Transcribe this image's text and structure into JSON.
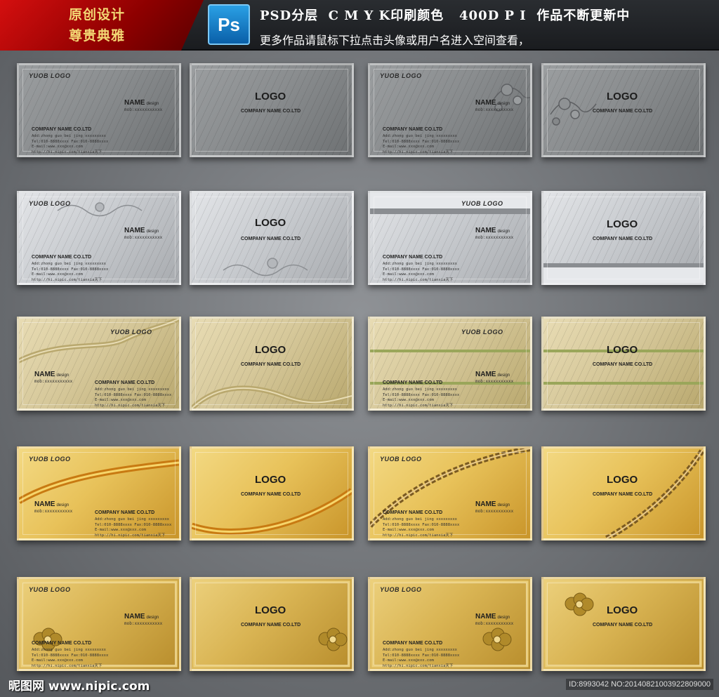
{
  "header": {
    "badge_line1": "原创设计",
    "badge_line2": "尊贵典雅",
    "app_icon": "Ps",
    "line1": "PSD分层  C M Y K印刷颜色   400D P I  作品不断更新中",
    "line2": "更多作品请鼠标下拉点击头像或用户名进入空间查看，"
  },
  "card_text": {
    "corner_logo": "YUOB LOGO",
    "name": "NAME",
    "name_suffix": "design",
    "mob": "mob:xxxxxxxxxxx",
    "company": "COMPANY NAME CO.LTD",
    "info": "Add:zhong guo bei jing xxxxxxxxx\nTel:010-8888xxxx Fax:010-8888xxxx\nE-mail:www.xxx@xxx.com\nhttp://hi.nipic.com/tianxia天下",
    "logo": "LOGO",
    "company_center": "COMPANY NAME CO.LTD"
  },
  "rows": [
    {
      "theme": "dark-silver-pattern",
      "colors": [
        "#8a8d8f",
        "#6e7173",
        "#9b9ea0"
      ]
    },
    {
      "theme": "brushed-silver",
      "colors": [
        "#c9ccd0",
        "#a8abaf",
        "#e3e5e8"
      ]
    },
    {
      "theme": "pale-gold",
      "colors": [
        "#d6c89a",
        "#b9a86e",
        "#e8dcb4"
      ]
    },
    {
      "theme": "bright-gold",
      "colors": [
        "#e8c25a",
        "#c9952a",
        "#f3d983"
      ]
    },
    {
      "theme": "rich-gold",
      "colors": [
        "#d9b453",
        "#b88d2c",
        "#ecd07c"
      ]
    }
  ],
  "footer": {
    "watermark": "昵图网 www.nipic.com",
    "id": "ID:8993042 NO:20140821003922809000"
  }
}
